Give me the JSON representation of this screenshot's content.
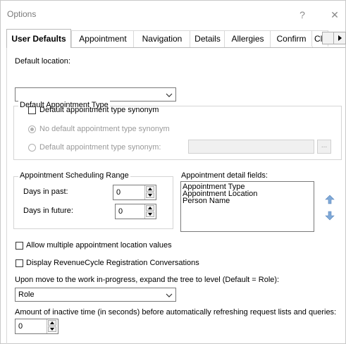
{
  "window": {
    "title": "Options",
    "help_glyph": "?",
    "close_glyph": "✕"
  },
  "tabs": [
    {
      "label": "User Defaults",
      "active": true
    },
    {
      "label": "Appointment"
    },
    {
      "label": "Navigation"
    },
    {
      "label": "Details"
    },
    {
      "label": "Allergies"
    },
    {
      "label": "Confirm"
    },
    {
      "label": "Cl"
    }
  ],
  "default_location": {
    "label": "Default location:",
    "value": ""
  },
  "appt_type_group": {
    "title": "Default Appointment Type",
    "synonym_checkbox_label": "Default appointment type synonym",
    "synonym_checked": false,
    "radio_none_label": "No default appointment type synonym",
    "radio_none_checked": true,
    "radio_synonym_label": "Default appointment type synonym:",
    "synonym_value": "",
    "browse_label": "..."
  },
  "scheduling_group": {
    "title": "Appointment Scheduling Range",
    "days_past_label": "Days in past:",
    "days_past_value": "0",
    "days_future_label": "Days in future:",
    "days_future_value": "0"
  },
  "detail_fields": {
    "label": "Appointment detail fields:",
    "items": [
      "Appointment Type",
      "Appointment Location",
      "Person Name"
    ]
  },
  "allow_multiple": {
    "label": "Allow multiple appointment location values",
    "checked": false
  },
  "display_revenue": {
    "label": "Display RevenueCycle Registration Conversations",
    "checked": false
  },
  "tree_level": {
    "label": "Upon move to the work in-progress, expand the tree to level (Default = Role):",
    "value": "Role"
  },
  "inactive_time": {
    "label": "Amount of inactive time (in seconds) before automatically refreshing request lists and queries:",
    "value": "0"
  },
  "colors": {
    "accent_arrow": "#7fa9d8",
    "border": "#7a7a7a"
  }
}
